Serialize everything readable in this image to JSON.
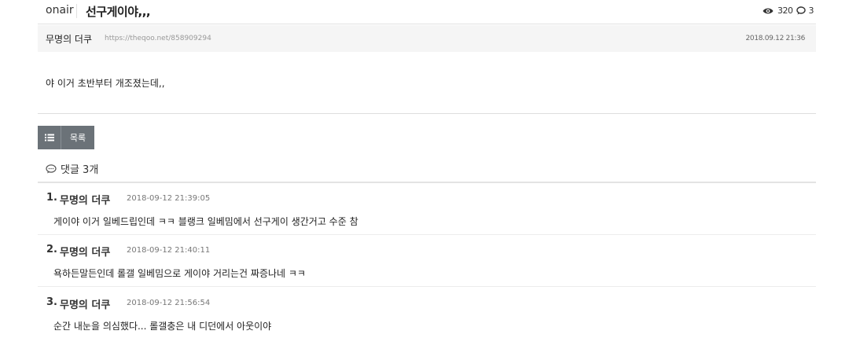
{
  "post": {
    "category": "onair",
    "title": "선구게이야,,,",
    "views": "320",
    "comment_count": "3",
    "author": "무명의 더쿠",
    "url": "https://theqoo.net/858909294",
    "date": "2018.09.12 21:36",
    "content": "야 이거 초반부터 개조졌는데,,"
  },
  "toolbar": {
    "list_label": "목록"
  },
  "comments_section": {
    "header": "댓글 3개"
  },
  "comments": [
    {
      "num": "1.",
      "author": "무명의 더쿠",
      "time": "2018-09-12 21:39:05",
      "text": "게이야 이거 일베드립인데 ㅋㅋ 블랭크 일베밈에서 선구게이 생간거고 수준 참"
    },
    {
      "num": "2.",
      "author": "무명의 더쿠",
      "time": "2018-09-12 21:40:11",
      "text": "욕하든말든인데 롤갤 일베밈으로 게이야 거리는건 짜증나네 ㅋㅋ"
    },
    {
      "num": "3.",
      "author": "무명의 더쿠",
      "time": "2018-09-12 21:56:54",
      "text": "순간 내눈을 의심했다... 롤갤충은 내 디던에서 아웃이야"
    }
  ],
  "icons": {
    "views": "eye-icon",
    "comments": "speech-bubble-icon",
    "list": "list-icon"
  },
  "colors": {
    "button_bg": "#6b7278",
    "meta_bg": "#f5f5f5"
  }
}
